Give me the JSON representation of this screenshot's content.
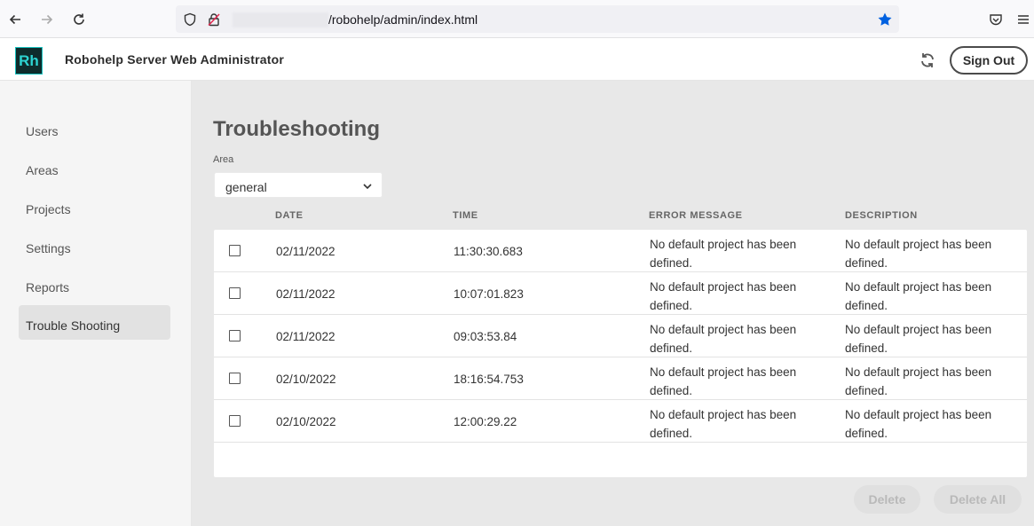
{
  "browser": {
    "url": "/robohelp/admin/index.html"
  },
  "header": {
    "logo_text": "Rh",
    "title": "Robohelp Server Web Administrator",
    "sign_out_label": "Sign Out"
  },
  "sidebar": {
    "items": [
      {
        "label": "Users"
      },
      {
        "label": "Areas"
      },
      {
        "label": "Projects"
      },
      {
        "label": "Settings"
      },
      {
        "label": "Reports"
      },
      {
        "label": "Trouble Shooting",
        "active": true
      }
    ]
  },
  "main": {
    "title": "Troubleshooting",
    "area_label": "Area",
    "area_value": "general",
    "columns": [
      "DATE",
      "TIME",
      "ERROR MESSAGE",
      "DESCRIPTION"
    ],
    "rows": [
      {
        "date": "02/11/2022",
        "time": "11:30:30.683",
        "error": "No default project has been defined.",
        "description": "No default project has been defined.",
        "checked": false
      },
      {
        "date": "02/11/2022",
        "time": "10:07:01.823",
        "error": "No default project has been defined.",
        "description": "No default project has been defined.",
        "checked": false
      },
      {
        "date": "02/11/2022",
        "time": "09:03:53.84",
        "error": "No default project has been defined.",
        "description": "No default project has been defined.",
        "checked": false
      },
      {
        "date": "02/10/2022",
        "time": "18:16:54.753",
        "error": "No default project has been defined.",
        "description": "No default project has been defined.",
        "checked": false
      },
      {
        "date": "02/10/2022",
        "time": "12:00:29.22",
        "error": "No default project has been defined.",
        "description": "No default project has been defined.",
        "checked": false
      }
    ],
    "delete_label": "Delete",
    "delete_all_label": "Delete All"
  },
  "colors": {
    "highlight": "#f7f700",
    "logo_accent": "#2dd4d2"
  }
}
